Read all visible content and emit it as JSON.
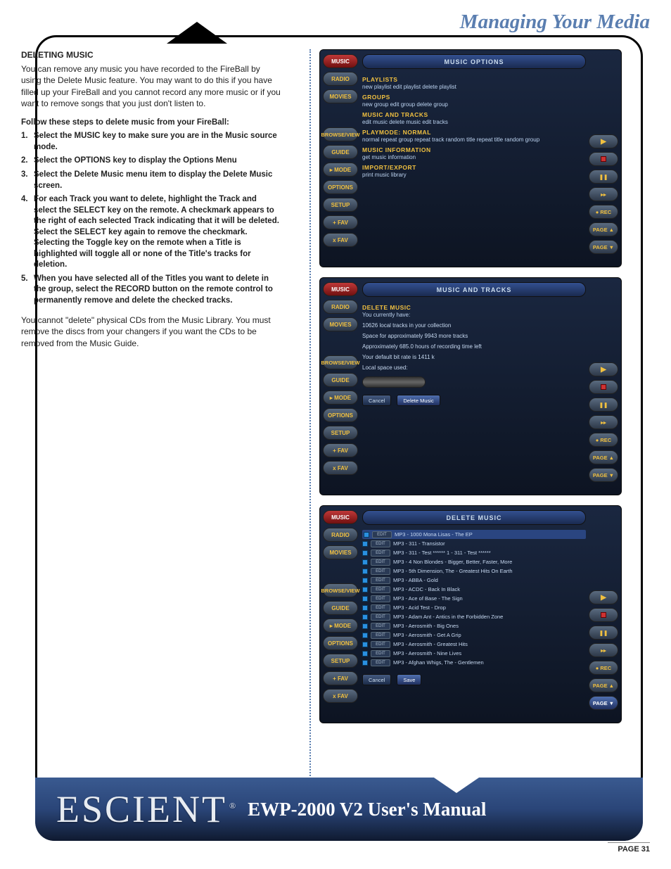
{
  "page": {
    "title": "Managing Your Media",
    "section_heading": "DELETING MUSIC",
    "intro": "You can remove any music you have recorded to the FireBall by using the Delete Music feature. You may want to do this if you have filled up your FireBall and you cannot record any more music or if you want to remove songs that you just don't listen to.",
    "follow_label": "Follow these steps to delete music from your FireBall:",
    "steps": [
      "Select the MUSIC key to make sure you are in the Music source mode.",
      "Select the OPTIONS key to display the Options Menu",
      "Select the Delete Music menu item to display the Delete Music screen.",
      "For each Track you want to delete, highlight the Track and select the SELECT key on the remote. A checkmark appears to the right of each selected Track indicating that it will be deleted. Select the SELECT key again to remove the checkmark. Selecting the Toggle key on the remote when a Title is highlighted will toggle all or none of the Title's tracks for deletion.",
      "When you have selected all of the Titles you want to delete in the group, select the RECORD button on the remote control to permanently remove and delete the checked tracks."
    ],
    "outro": "You cannot \"delete\" physical CDs from the Music Library. You must remove the discs from your changers if you want the CDs to be removed from the Music Guide.",
    "page_label": "PAGE 31"
  },
  "brand": {
    "name": "ESCIENT",
    "reg": "®",
    "manual": "EWP-2000 V2 User's Manual"
  },
  "tabs": {
    "music": "MUSIC",
    "radio": "RADIO",
    "movies": "MOVIES",
    "browse": "BROWSE/VIEW",
    "guide": "GUIDE",
    "mode": "▸ MODE",
    "options": "OPTIONS",
    "setup": "SETUP",
    "plusfav": "+ FAV",
    "xfav": "x FAV"
  },
  "side_buttons": {
    "rec": "● REC",
    "pagep": "PAGE ▲",
    "pagen": "PAGE ▼"
  },
  "screen1": {
    "title_bar": "MUSIC OPTIONS",
    "groups": [
      {
        "head": "PLAYLISTS",
        "sub": "new playlist   edit playlist   delete playlist"
      },
      {
        "head": "GROUPS",
        "sub": "new group   edit group   delete group"
      },
      {
        "head": "MUSIC AND TRACKS",
        "sub": "edit music   delete music   edit tracks"
      },
      {
        "head": "PLAYMODE: NORMAL",
        "sub": "normal   repeat group   repeat track   random title   repeat title   random group"
      },
      {
        "head": "MUSIC INFORMATION",
        "sub": "get music information"
      },
      {
        "head": "IMPORT/EXPORT",
        "sub": "print music library"
      }
    ]
  },
  "screen2": {
    "title_bar": "MUSIC AND TRACKS",
    "sect": "DELETE MUSIC",
    "you_have": "You currently have:",
    "l1": "10626 local tracks in your collection",
    "l2": "Space for approximately 9943 more tracks",
    "l3": "Approximately 685.0 hours of recording time left",
    "l4": "Your default bit rate is 1411 k",
    "l5": "Local space used:",
    "btn_cancel": "Cancel",
    "btn_del": "Delete Music"
  },
  "screen3": {
    "title_bar": "DELETE MUSIC",
    "edit": "EDIT",
    "rows": [
      "MP3 - 1000 Mona Lisas - The EP",
      "MP3 - 311 - Transistor",
      "MP3 - 311 - Test ****** 1 - 311 - Test ******",
      "MP3 - 4 Non Blondes - Bigger, Better, Faster, More",
      "MP3 - 5th Dimension, The - Greatest Hits On Earth",
      "MP3 - ABBA - Gold",
      "MP3 - ACDC - Back In Black",
      "MP3 - Ace of Base - The Sign",
      "MP3 - Acid Test - Drop",
      "MP3 - Adam Ant - Antics in the Forbidden Zone",
      "MP3 - Aerosmith - Big Ones",
      "MP3 - Aerosmith - Get A Grip",
      "MP3 - Aerosmith - Greatest Hits",
      "MP3 - Aerosmith - Nine Lives",
      "MP3 - Afghan Whigs, The - Gentlemen"
    ],
    "btn_cancel": "Cancel",
    "btn_save": "Save"
  }
}
